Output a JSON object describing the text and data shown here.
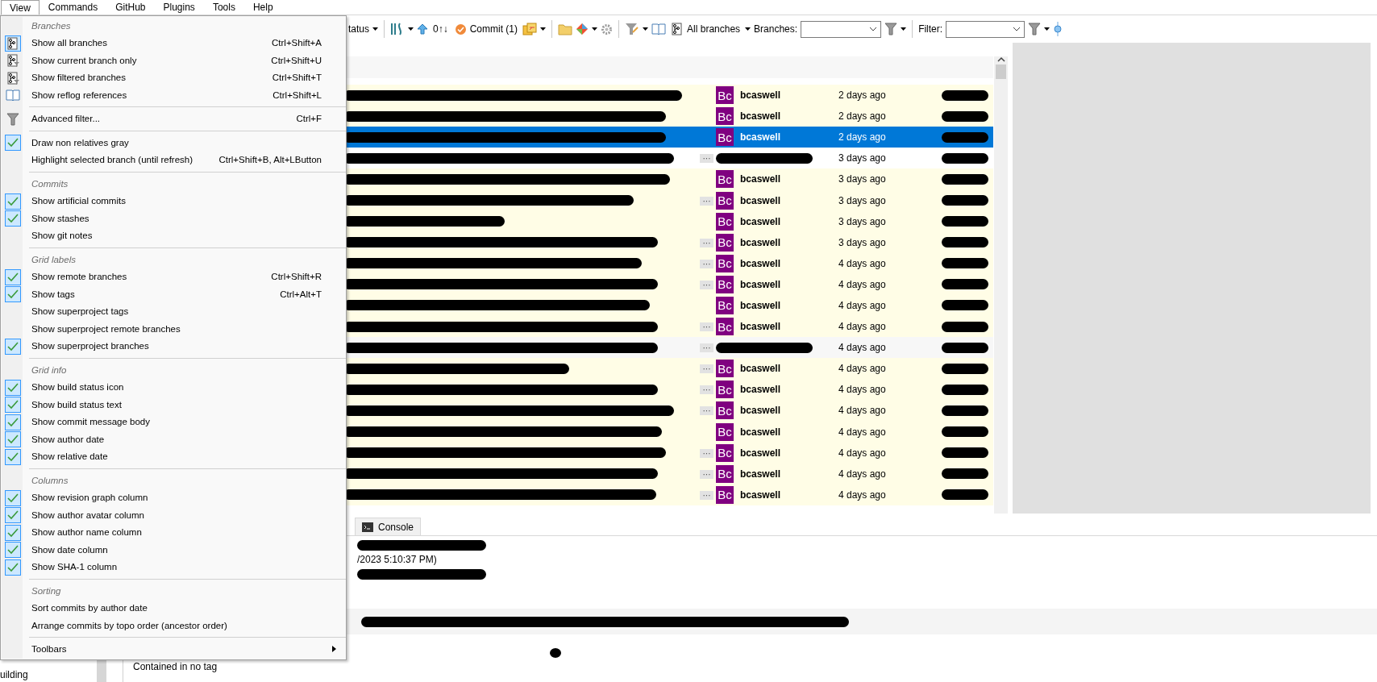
{
  "menubar": [
    {
      "label": "View",
      "selected": true
    },
    {
      "label": "Commands",
      "selected": false
    },
    {
      "label": "GitHub",
      "selected": false
    },
    {
      "label": "Plugins",
      "selected": false
    },
    {
      "label": "Tools",
      "selected": false
    },
    {
      "label": "Help",
      "selected": false
    }
  ],
  "toolbar": {
    "status_partial": "tatus",
    "pull_counts": "0↑↓",
    "commit": "Commit (1)",
    "branch_mode": "All branches",
    "branches_label": "Branches:",
    "filter_label": "Filter:"
  },
  "view_menu": [
    {
      "header": "Branches",
      "items": [
        {
          "kind": "icon",
          "label": "Show all branches",
          "shortcut": "Ctrl+Shift+A",
          "checked": true
        },
        {
          "kind": "icon",
          "label": "Show current branch only",
          "shortcut": "Ctrl+Shift+U",
          "checked": false
        },
        {
          "kind": "icon",
          "label": "Show filtered branches",
          "shortcut": "Ctrl+Shift+T",
          "checked": false
        },
        {
          "kind": "icon",
          "label": "Show reflog references",
          "shortcut": "Ctrl+Shift+L",
          "checked": false
        }
      ]
    },
    {
      "items": [
        {
          "kind": "icon",
          "label": "Advanced filter...",
          "shortcut": "Ctrl+F",
          "checked": false
        }
      ]
    },
    {
      "items": [
        {
          "kind": "check",
          "label": "Draw non relatives gray",
          "checked": true
        },
        {
          "kind": "check",
          "label": "Highlight selected branch (until refresh)",
          "shortcut": "Ctrl+Shift+B, Alt+LButton",
          "checked": false
        }
      ]
    },
    {
      "header": "Commits",
      "items": [
        {
          "kind": "check",
          "label": "Show artificial commits",
          "checked": true
        },
        {
          "kind": "check",
          "label": "Show stashes",
          "checked": true
        },
        {
          "kind": "check",
          "label": "Show git notes",
          "checked": false
        }
      ]
    },
    {
      "header": "Grid labels",
      "items": [
        {
          "kind": "check",
          "label": "Show remote branches",
          "shortcut": "Ctrl+Shift+R",
          "checked": true
        },
        {
          "kind": "check",
          "label": "Show tags",
          "shortcut": "Ctrl+Alt+T",
          "checked": true
        },
        {
          "kind": "check",
          "label": "Show superproject tags",
          "checked": false
        },
        {
          "kind": "check",
          "label": "Show superproject remote branches",
          "checked": false
        },
        {
          "kind": "check",
          "label": "Show superproject branches",
          "checked": true
        }
      ]
    },
    {
      "header": "Grid info",
      "items": [
        {
          "kind": "check",
          "label": "Show build status icon",
          "checked": true
        },
        {
          "kind": "check",
          "label": "Show build status text",
          "checked": true
        },
        {
          "kind": "check",
          "label": "Show commit message body",
          "checked": true
        },
        {
          "kind": "check",
          "label": "Show author date",
          "checked": true
        },
        {
          "kind": "check",
          "label": "Show relative date",
          "checked": true
        }
      ]
    },
    {
      "header": "Columns",
      "items": [
        {
          "kind": "check",
          "label": "Show revision graph column",
          "checked": true
        },
        {
          "kind": "check",
          "label": "Show author avatar column",
          "checked": true
        },
        {
          "kind": "check",
          "label": "Show author name column",
          "checked": true
        },
        {
          "kind": "check",
          "label": "Show date column",
          "checked": true
        },
        {
          "kind": "check",
          "label": "Show SHA-1 column",
          "checked": true
        }
      ]
    },
    {
      "header": "Sorting",
      "items": [
        {
          "kind": "check",
          "label": "Sort commits by author date",
          "checked": false
        },
        {
          "kind": "check",
          "label": "Arrange commits by topo order (ancestor order)",
          "checked": false
        }
      ]
    },
    {
      "items": [
        {
          "kind": "submenu",
          "label": "Toolbars"
        }
      ]
    }
  ],
  "commits": [
    {
      "kind": "author",
      "avatar": "Bc",
      "author": "bcaswell",
      "date": "2 days ago",
      "selected": false
    },
    {
      "kind": "author",
      "avatar": "Bc",
      "author": "bcaswell",
      "date": "2 days ago",
      "selected": false
    },
    {
      "kind": "author",
      "avatar": "Bc",
      "author": "bcaswell",
      "date": "2 days ago",
      "selected": true
    },
    {
      "kind": "hidden",
      "date": "3 days ago",
      "selected": false,
      "more": "···"
    },
    {
      "kind": "author",
      "avatar": "Bc",
      "author": "bcaswell",
      "date": "3 days ago",
      "selected": false
    },
    {
      "kind": "author",
      "avatar": "Bc",
      "author": "bcaswell",
      "date": "3 days ago",
      "selected": false,
      "more": "···"
    },
    {
      "kind": "author",
      "avatar": "Bc",
      "author": "bcaswell",
      "date": "3 days ago",
      "selected": false
    },
    {
      "kind": "author",
      "avatar": "Bc",
      "author": "bcaswell",
      "date": "3 days ago",
      "selected": false,
      "more": "···"
    },
    {
      "kind": "author",
      "avatar": "Bc",
      "author": "bcaswell",
      "date": "4 days ago",
      "selected": false,
      "more": "···"
    },
    {
      "kind": "author",
      "avatar": "Bc",
      "author": "bcaswell",
      "date": "4 days ago",
      "selected": false,
      "more": "···"
    },
    {
      "kind": "author",
      "avatar": "Bc",
      "author": "bcaswell",
      "date": "4 days ago",
      "selected": false
    },
    {
      "kind": "author",
      "avatar": "Bc",
      "author": "bcaswell",
      "date": "4 days ago",
      "selected": false,
      "more": "···"
    },
    {
      "kind": "hidden",
      "date": "4 days ago",
      "selected": false,
      "more": "···"
    },
    {
      "kind": "author",
      "avatar": "Bc",
      "author": "bcaswell",
      "date": "4 days ago",
      "selected": false,
      "more": "···"
    },
    {
      "kind": "author",
      "avatar": "Bc",
      "author": "bcaswell",
      "date": "4 days ago",
      "selected": false,
      "more": "···"
    },
    {
      "kind": "author",
      "avatar": "Bc",
      "author": "bcaswell",
      "date": "4 days ago",
      "selected": false,
      "more": "···"
    },
    {
      "kind": "author",
      "avatar": "Bc",
      "author": "bcaswell",
      "date": "4 days ago",
      "selected": false
    },
    {
      "kind": "author",
      "avatar": "Bc",
      "author": "bcaswell",
      "date": "4 days ago",
      "selected": false,
      "more": "···"
    },
    {
      "kind": "author",
      "avatar": "Bc",
      "author": "bcaswell",
      "date": "4 days ago",
      "selected": false,
      "more": "···"
    },
    {
      "kind": "author",
      "avatar": "Bc",
      "author": "bcaswell",
      "date": "4 days ago",
      "selected": false,
      "more": "···"
    }
  ],
  "detail_tabs": [
    {
      "label": "Console",
      "selected": false
    }
  ],
  "details": {
    "date_partial": "/2023 5:10:37 PM)",
    "tags": "Contained in no tag"
  },
  "left_tree": {
    "item_partial": "uilding"
  }
}
